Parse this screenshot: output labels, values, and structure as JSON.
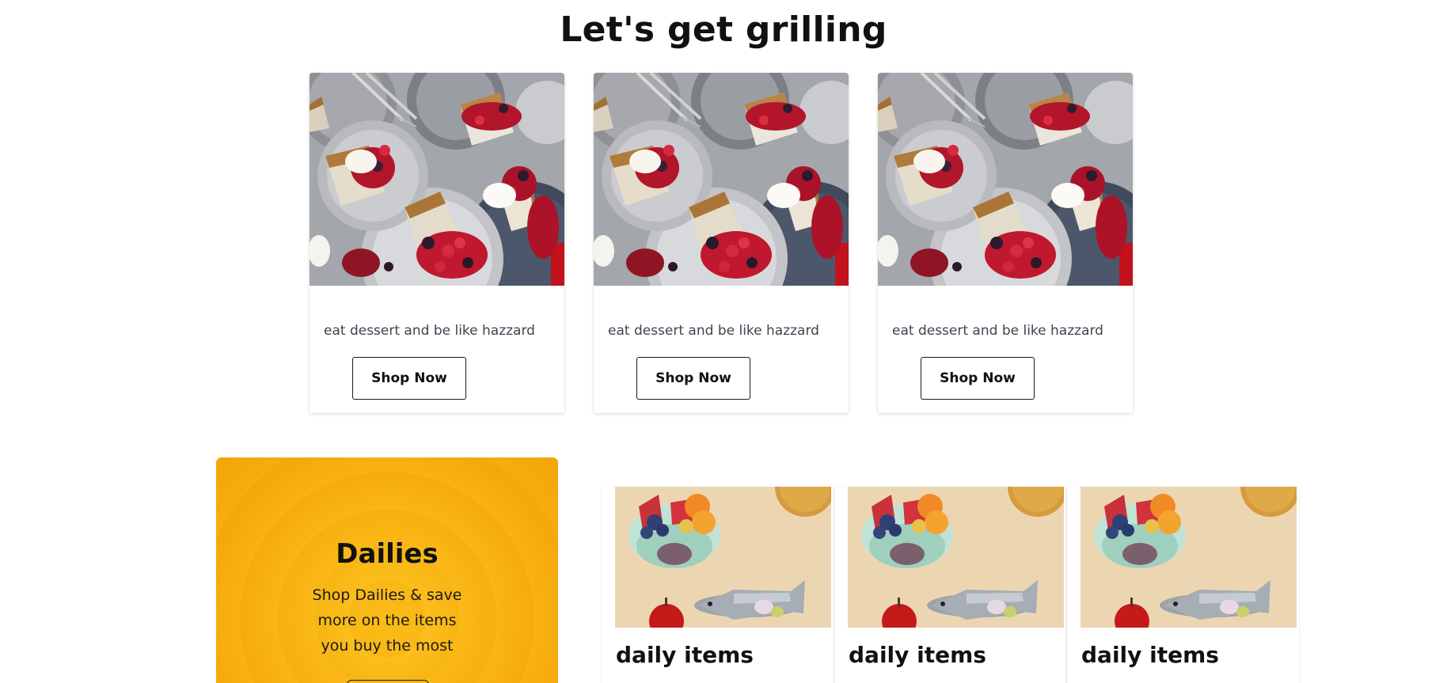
{
  "grilling": {
    "title": "Let's get grilling",
    "cards": [
      {
        "text": "eat dessert and be like hazzard",
        "button": "Shop Now",
        "image": "dessert-plates-image"
      },
      {
        "text": "eat dessert and be like hazzard",
        "button": "Shop Now",
        "image": "dessert-plates-image"
      },
      {
        "text": "eat dessert and be like hazzard",
        "button": "Shop Now",
        "image": "dessert-plates-image"
      }
    ]
  },
  "dailies": {
    "title": "Dailies",
    "description": "Shop Dailies & save more on the items you buy the most",
    "background_color": "#f7b10f"
  },
  "daily_items": [
    {
      "title": "daily items",
      "image": "fruit-fish-groceries-image"
    },
    {
      "title": "daily items",
      "image": "fruit-fish-groceries-image"
    },
    {
      "title": "daily items",
      "image": "fruit-fish-groceries-image"
    }
  ]
}
